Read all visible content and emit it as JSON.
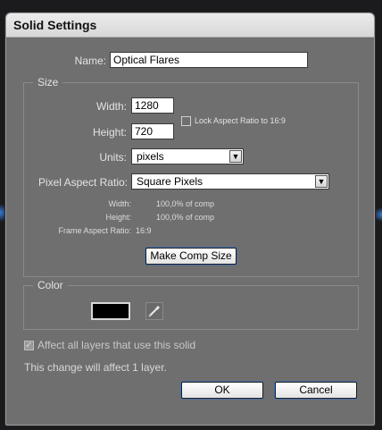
{
  "dialog": {
    "title": "Solid Settings"
  },
  "name": {
    "label": "Name:",
    "value": "Optical Flares"
  },
  "size": {
    "group_label": "Size",
    "width_label": "Width:",
    "width_value": "1280",
    "height_label": "Height:",
    "height_value": "720",
    "lock_label": "Lock Aspect Ratio to 16:9",
    "lock_checked": false,
    "units_label": "Units:",
    "units_value": "pixels",
    "par_label": "Pixel Aspect Ratio:",
    "par_value": "Square Pixels",
    "info_width_label": "Width:",
    "info_width_value": "100,0% of comp",
    "info_height_label": "Height:",
    "info_height_value": "100,0% of comp",
    "info_frame_label": "Frame Aspect Ratio:",
    "info_frame_value": "16:9",
    "make_comp_size_label": "Make Comp Size"
  },
  "color": {
    "group_label": "Color",
    "swatch_color": "#000000"
  },
  "affect": {
    "checkbox_label": "Affect all layers that use this solid",
    "checked": true,
    "note": "This change will affect 1 layer."
  },
  "buttons": {
    "ok_label": "OK",
    "cancel_label": "Cancel"
  }
}
